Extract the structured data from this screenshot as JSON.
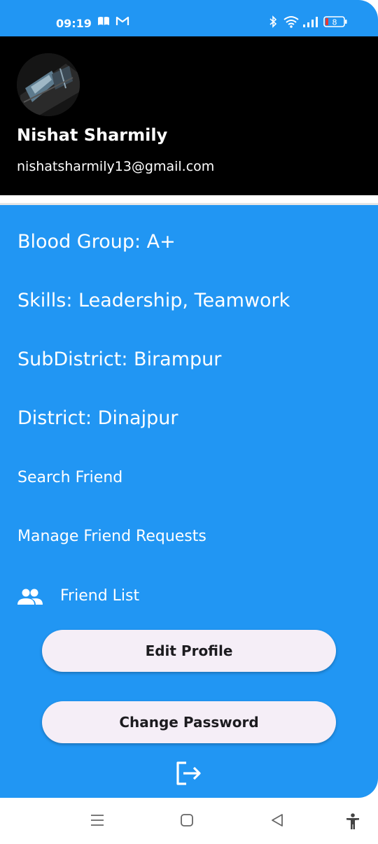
{
  "status_bar": {
    "time": "09:19",
    "battery": "8",
    "icons": [
      "book-icon",
      "gmail-icon",
      "bluetooth-icon",
      "wifi-icon",
      "signal-icon",
      "battery-icon"
    ]
  },
  "profile": {
    "name": "Nishat Sharmily",
    "email": "nishatsharmily13@gmail.com"
  },
  "info": {
    "blood_group": "Blood Group: A+",
    "skills": "Skills: Leadership, Teamwork",
    "subdistrict": "SubDistrict: Birampur",
    "district": "District: Dinajpur"
  },
  "nav": {
    "search_friend": "Search Friend",
    "manage_requests": "Manage Friend Requests",
    "friend_list": "Friend List"
  },
  "buttons": {
    "edit_profile": "Edit Profile",
    "change_password": "Change Password"
  },
  "colors": {
    "drawer_bg": "#2196F3",
    "header_bg": "#000000",
    "button_bg": "#F5EEF7"
  }
}
